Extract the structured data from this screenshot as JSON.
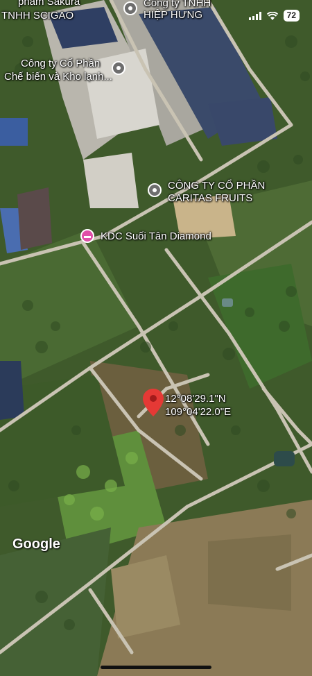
{
  "status_bar": {
    "battery": "72",
    "icons": [
      "signal-icon",
      "wifi-icon",
      "battery-icon"
    ]
  },
  "places": {
    "sakura": "phẩm Sakura",
    "tnhh_scigao": "TNHH SCIGAO",
    "hiep_hung_line1": "Công ty TNHH",
    "hiep_hung_line2": "HIỆP HƯNG",
    "co_phan_line1": "Công ty Cổ Phần",
    "co_phan_line2": "Chế biến và Kho lạnh...",
    "caritas_line1": "CÔNG TY CỔ PHẦN",
    "caritas_line2": "CARITAS FRUITS",
    "kdc": "KDC Suối Tân Diamond"
  },
  "dropped_pin": {
    "lat": "12°08'29.1\"N",
    "lng": "109°04'22.0\"E",
    "color": "#e53935"
  },
  "branding": {
    "logo": "Google"
  },
  "colors": {
    "hotel_pin": "#e04fa8",
    "poi_pin": "#6e6e6e"
  }
}
